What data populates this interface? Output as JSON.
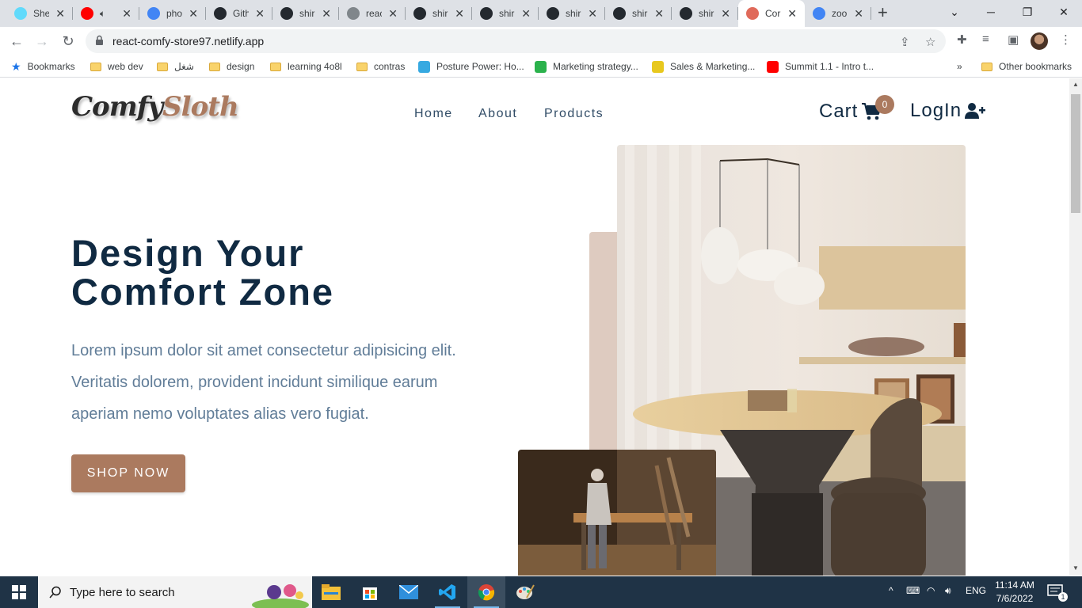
{
  "browser": {
    "tabs": [
      {
        "title": "She",
        "favicon": "react-icon",
        "color": "#61dafb"
      },
      {
        "title": "",
        "favicon": "youtube-icon",
        "color": "#ff0000",
        "audio": true
      },
      {
        "title": "pho",
        "favicon": "google-icon",
        "color": "#4285f4"
      },
      {
        "title": "Gith",
        "favicon": "github-icon",
        "color": "#24292f"
      },
      {
        "title": "shir",
        "favicon": "github-icon",
        "color": "#24292f"
      },
      {
        "title": "reac",
        "favicon": "globe-icon",
        "color": "#80868b"
      },
      {
        "title": "shir",
        "favicon": "github-icon",
        "color": "#24292f"
      },
      {
        "title": "shir",
        "favicon": "github-icon",
        "color": "#24292f"
      },
      {
        "title": "shir",
        "favicon": "github-icon",
        "color": "#24292f"
      },
      {
        "title": "shir",
        "favicon": "github-icon",
        "color": "#24292f"
      },
      {
        "title": "shir",
        "favicon": "github-icon",
        "color": "#24292f"
      },
      {
        "title": "Cor",
        "favicon": "comfy-icon",
        "color": "#e06a5a",
        "active": true
      },
      {
        "title": "zoo",
        "favicon": "google-icon",
        "color": "#4285f4"
      }
    ],
    "url": "react-comfy-store97.netlify.app"
  },
  "bookmarks": [
    {
      "label": "Bookmarks",
      "icon": "star-icon"
    },
    {
      "label": "web dev",
      "icon": "folder-icon"
    },
    {
      "label": "شغل",
      "icon": "folder-icon"
    },
    {
      "label": "design",
      "icon": "folder-icon"
    },
    {
      "label": "learning 4o8l",
      "icon": "folder-icon"
    },
    {
      "label": "contras",
      "icon": "folder-icon"
    },
    {
      "label": "Posture Power: Ho...",
      "icon": "posture-icon"
    },
    {
      "label": "Marketing strategy...",
      "icon": "udemy-icon"
    },
    {
      "label": "Sales & Marketing...",
      "icon": "sales-icon"
    },
    {
      "label": "Summit 1.1 - Intro t...",
      "icon": "youtube-icon"
    },
    {
      "label": "»",
      "icon": "chevron-icon"
    },
    {
      "label": "Other bookmarks",
      "icon": "folder-icon"
    }
  ],
  "site": {
    "logo": {
      "part1": "Comfy",
      "part2": "Sloth"
    },
    "nav": [
      "Home",
      "About",
      "Products"
    ],
    "cart_label": "Cart",
    "cart_count": "0",
    "login_label": "LogIn",
    "hero": {
      "title_line1": "Design Your",
      "title_line2": "Comfort Zone",
      "text": "Lorem ipsum dolor sit amet consectetur adipisicing elit. Veritatis dolorem, provident incidunt similique earum aperiam nemo voluptates alias vero fugiat.",
      "button": "SHOP NOW"
    },
    "colors": {
      "primary": "#ab7a5f",
      "heading": "#102a42",
      "text": "#617d98",
      "accent_light": "#decbc0"
    }
  },
  "taskbar": {
    "search_placeholder": "Type here to search",
    "language": "ENG",
    "time": "11:14 AM",
    "date": "7/6/2022",
    "notification_count": "1"
  }
}
